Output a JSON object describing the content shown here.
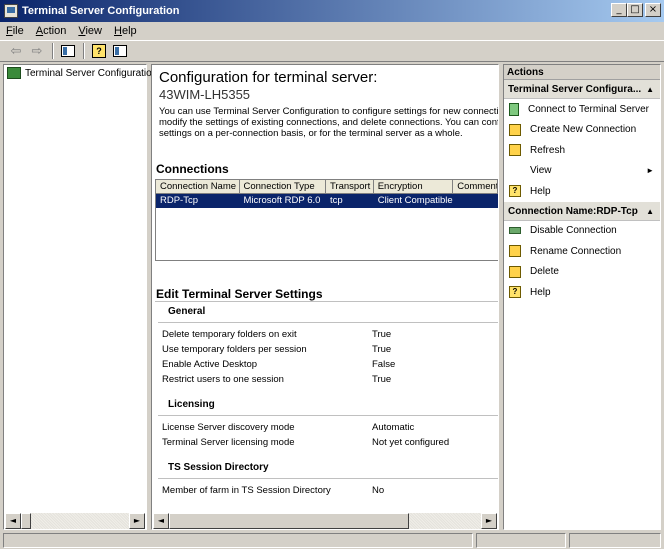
{
  "window": {
    "title": "Terminal Server Configuration"
  },
  "menu": {
    "items": [
      "File",
      "Action",
      "View",
      "Help"
    ]
  },
  "toolbar": {
    "icons": [
      "back-arrow-icon",
      "forward-arrow-icon",
      "show-hide-console-tree-icon",
      "help-icon",
      "show-hide-action-pane-icon"
    ]
  },
  "tree": {
    "root_label": "Terminal Server Configuration:"
  },
  "main": {
    "heading": "Configuration for terminal server:",
    "server_name": "43WIM-LH5355",
    "description": "You can use Terminal Server Configuration to configure settings for new connections,\nmodify the settings of existing connections, and delete connections. You can configure\nsettings on a per-connection basis, or for the terminal server as a whole.",
    "connections_heading": "Connections",
    "connections_columns": [
      "Connection Name",
      "Connection Type",
      "Transport",
      "Encryption",
      "Comment"
    ],
    "connections_rows": [
      {
        "name": "RDP-Tcp",
        "type": "Microsoft RDP 6.0",
        "transport": "tcp",
        "encryption": "Client Compatible",
        "comment": ""
      }
    ],
    "settings_heading": "Edit Terminal Server Settings",
    "groups": {
      "general": {
        "title": "General",
        "rows": [
          {
            "label": "Delete temporary folders on exit",
            "value": "True"
          },
          {
            "label": "Use temporary folders per session",
            "value": "True"
          },
          {
            "label": "Enable Active Desktop",
            "value": "False"
          },
          {
            "label": "Restrict users to one session",
            "value": "True"
          }
        ]
      },
      "licensing": {
        "title": "Licensing",
        "rows": [
          {
            "label": "License Server discovery mode",
            "value": "Automatic"
          },
          {
            "label": "Terminal Server licensing mode",
            "value": "Not yet configured"
          }
        ]
      },
      "session_directory": {
        "title": "TS Session Directory",
        "rows": [
          {
            "label": "Member of farm in TS Session Directory",
            "value": "No"
          }
        ]
      }
    }
  },
  "actions": {
    "title": "Actions",
    "group1": {
      "title": "Terminal Server Configura...",
      "items": [
        "Connect to Terminal Server",
        "Create New Connection",
        "Refresh",
        "View",
        "Help"
      ]
    },
    "group2": {
      "title": "Connection Name:RDP-Tcp",
      "items": [
        "Disable Connection",
        "Rename Connection",
        "Delete",
        "Help"
      ]
    }
  },
  "colors": {
    "titlebar_start": "#0a246a",
    "titlebar_end": "#a6caf0",
    "selection": "#0a246a",
    "chrome": "#d4d0c8"
  }
}
